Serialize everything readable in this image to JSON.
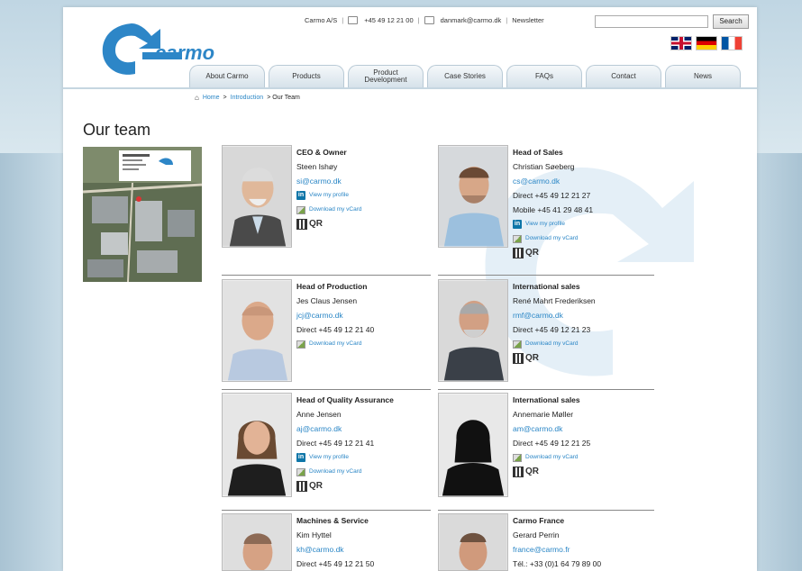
{
  "header": {
    "company": "Carmo A/S",
    "phone": "+45 49 12 21 00",
    "email": "danmark@carmo.dk",
    "newsletter": "Newsletter",
    "search_placeholder": "",
    "search_button": "Search",
    "logo_text": "carmo"
  },
  "nav": [
    {
      "label": "About Carmo"
    },
    {
      "label": "Products"
    },
    {
      "label": "Product Development"
    },
    {
      "label": "Case Stories"
    },
    {
      "label": "FAQs"
    },
    {
      "label": "Contact"
    },
    {
      "label": "News"
    }
  ],
  "breadcrumb": [
    "Home",
    ">",
    "Introduction",
    "> Our Team"
  ],
  "page_title": "Our team",
  "labels": {
    "linkedin": "View my profile",
    "vcard": "Download my vCard",
    "qr": "QR"
  },
  "people": [
    {
      "role": "CEO & Owner",
      "name": "Steen Ishøy",
      "email": "si@carmo.dk"
    },
    {
      "role": "Head of Sales",
      "name": "Christian Søeberg",
      "email": "cs@carmo.dk",
      "direct": "Direct +45 49 12 21 27",
      "mobile": "Mobile +45 41 29 48 41"
    },
    {
      "role": "Head of Production",
      "name": "Jes Claus Jensen",
      "email": "jcj@carmo.dk",
      "direct": "Direct +45 49 12 21 40"
    },
    {
      "role": "International sales",
      "name": "René Mahrt Frederiksen",
      "email": "rmf@carmo.dk",
      "direct": "Direct +45 49 12 21 23"
    },
    {
      "role": "Head of Quality Assurance",
      "name": "Anne Jensen",
      "email": "aj@carmo.dk",
      "direct": "Direct +45 49 12 21 41"
    },
    {
      "role": "International sales",
      "name": "Annemarie Møller",
      "email": "am@carmo.dk",
      "direct": "Direct +45 49 12 21 25"
    },
    {
      "role": "Machines & Service",
      "name": "Kim Hyttel",
      "email": "kh@carmo.dk",
      "direct": "Direct +45 49 12 21 50"
    },
    {
      "role": "Carmo France",
      "name": "Gerard Perrin",
      "email": "france@carmo.fr",
      "direct": "Tél.: +33 (0)1 64 79 89 00"
    }
  ]
}
